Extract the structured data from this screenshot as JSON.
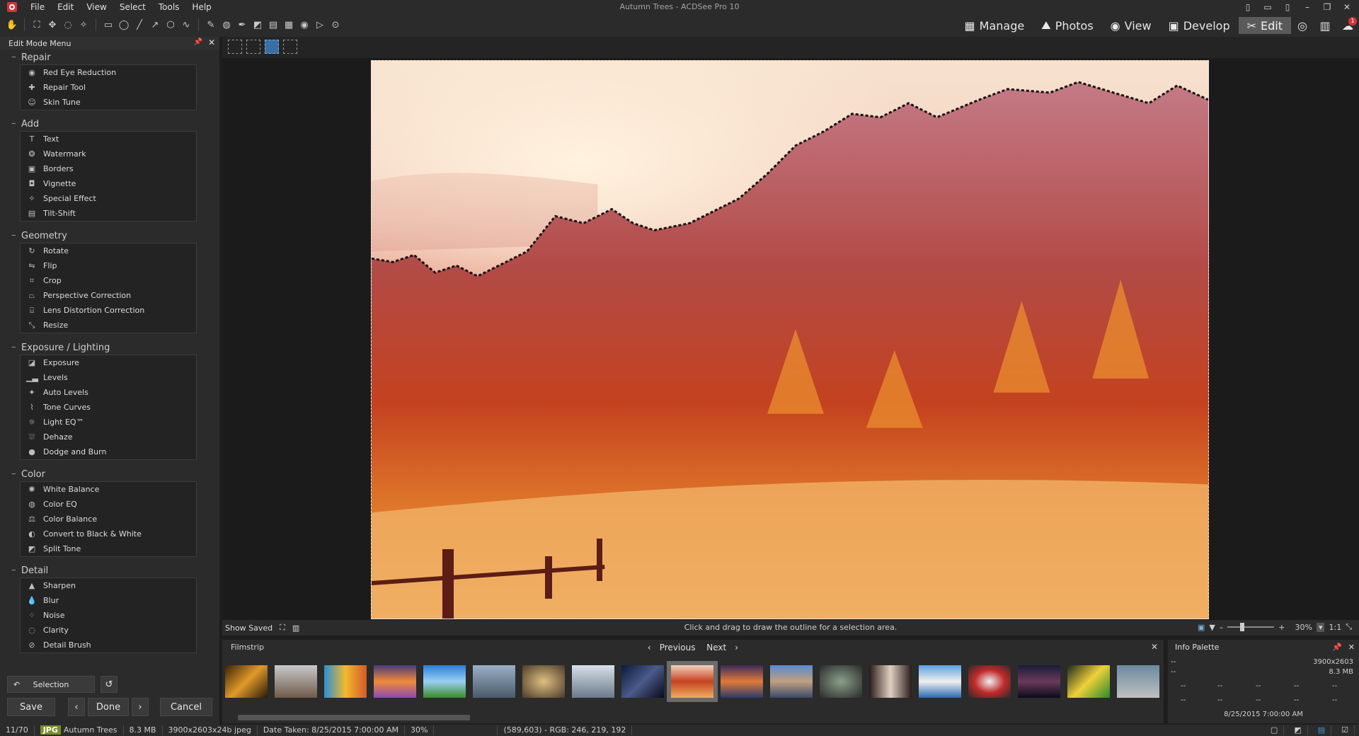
{
  "window": {
    "title": "Autumn Trees - ACDSee Pro 10"
  },
  "menu": [
    "File",
    "Edit",
    "View",
    "Select",
    "Tools",
    "Help"
  ],
  "modes": [
    {
      "label": "Manage",
      "icon": "grid-icon"
    },
    {
      "label": "Photos",
      "icon": "photos-icon"
    },
    {
      "label": "View",
      "icon": "eye-icon"
    },
    {
      "label": "Develop",
      "icon": "develop-icon"
    },
    {
      "label": "Edit",
      "icon": "edit-icon",
      "active": true
    }
  ],
  "notification_count": "1",
  "left_panel": {
    "title": "Edit Mode Menu",
    "groups": [
      {
        "title": "Repair",
        "items": [
          "Red Eye Reduction",
          "Repair Tool",
          "Skin Tune"
        ]
      },
      {
        "title": "Add",
        "items": [
          "Text",
          "Watermark",
          "Borders",
          "Vignette",
          "Special Effect",
          "Tilt-Shift"
        ]
      },
      {
        "title": "Geometry",
        "items": [
          "Rotate",
          "Flip",
          "Crop",
          "Perspective Correction",
          "Lens Distortion Correction",
          "Resize"
        ]
      },
      {
        "title": "Exposure / Lighting",
        "items": [
          "Exposure",
          "Levels",
          "Auto Levels",
          "Tone Curves",
          "Light EQ™",
          "Dehaze",
          "Dodge and Burn"
        ]
      },
      {
        "title": "Color",
        "items": [
          "White Balance",
          "Color EQ",
          "Color Balance",
          "Convert to Black & White",
          "Split Tone"
        ]
      },
      {
        "title": "Detail",
        "items": [
          "Sharpen",
          "Blur",
          "Noise",
          "Clarity",
          "Detail Brush"
        ]
      }
    ],
    "selection_label": "Selection",
    "save_label": "Save",
    "done_label": "Done",
    "cancel_label": "Cancel"
  },
  "canvas": {
    "show_saved_label": "Show Saved",
    "hint": "Click and drag to draw the outline for a selection area.",
    "zoom_level": "30%",
    "zoom_ratio_label": "1:1"
  },
  "filmstrip": {
    "title": "Filmstrip",
    "previous_label": "Previous",
    "next_label": "Next"
  },
  "info_palette": {
    "title": "Info Palette",
    "dash": "--",
    "dimensions": "3900x2603",
    "size": "8.3 MB",
    "date": "8/25/2015 7:00:00 AM"
  },
  "status": {
    "position": "11/70",
    "format": "JPG",
    "name": "Autumn Trees",
    "size": "8.3 MB",
    "dims": "3900x2603x24b jpeg",
    "date_taken": "Date Taken: 8/25/2015 7:00:00 AM",
    "zoom": "30%",
    "pixel": "(589,603) - RGB: 246, 219, 192"
  },
  "colors": {
    "accent": "#3a6fa3",
    "badge_red": "#d8323a",
    "panel": "#2b2b2b"
  }
}
